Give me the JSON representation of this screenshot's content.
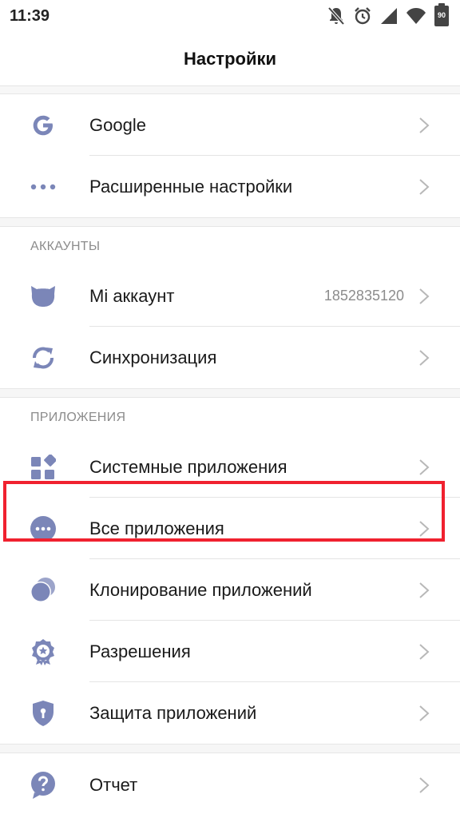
{
  "status_bar": {
    "time": "11:39",
    "battery": "90",
    "icons": [
      "notifications-off-icon",
      "alarm-icon",
      "signal-icon",
      "wifi-icon",
      "battery-icon"
    ]
  },
  "header": {
    "title": "Настройки"
  },
  "items": {
    "google": {
      "label": "Google",
      "icon": "google-icon"
    },
    "advanced": {
      "label": "Расширенные настройки",
      "icon": "more-dots-icon"
    },
    "mi_account": {
      "label": "Mi аккаунт",
      "value": "1852835120",
      "icon": "mi-account-icon"
    },
    "sync": {
      "label": "Синхронизация",
      "icon": "sync-icon"
    },
    "system_apps": {
      "label": "Системные приложения",
      "icon": "system-apps-icon"
    },
    "all_apps": {
      "label": "Все приложения",
      "icon": "all-apps-icon"
    },
    "dual_apps": {
      "label": "Клонирование приложений",
      "icon": "dual-apps-icon"
    },
    "permissions": {
      "label": "Разрешения",
      "icon": "permissions-icon"
    },
    "app_lock": {
      "label": "Защита приложений",
      "icon": "app-lock-icon"
    },
    "feedback": {
      "label": "Отчет",
      "icon": "help-icon"
    }
  },
  "sections": {
    "accounts": "АККАУНТЫ",
    "apps": "ПРИЛОЖЕНИЯ"
  },
  "colors": {
    "icon": "#7b86b8",
    "highlight": "#f0212f",
    "chevron": "#b8b8b8"
  }
}
